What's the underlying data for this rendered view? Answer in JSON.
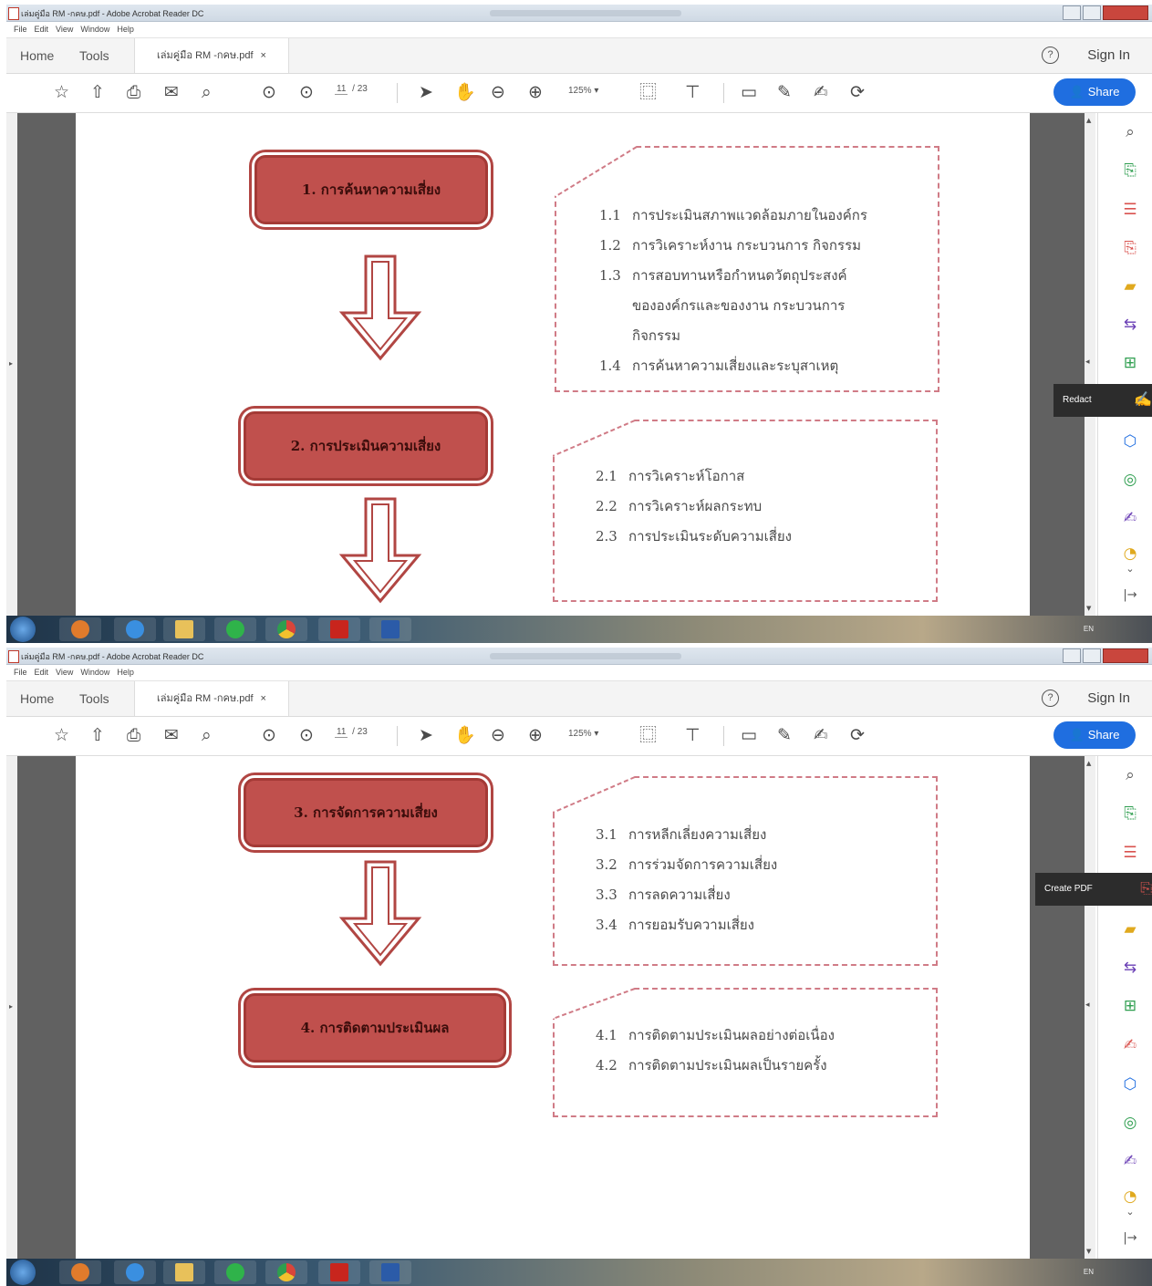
{
  "window": {
    "title": "เล่มคู่มือ RM -กคษ.pdf - Adobe Acrobat Reader DC",
    "menu": [
      "File",
      "Edit",
      "View",
      "Window",
      "Help"
    ]
  },
  "tabs": {
    "home": "Home",
    "tools": "Tools",
    "document": "เล่มคู่มือ RM -กคษ.pdf",
    "close": "×"
  },
  "header": {
    "help": "?",
    "sign_in": "Sign In",
    "share": "Share"
  },
  "toolbar": {
    "page_current": "11",
    "page_total": "/ 23",
    "zoom": "125%",
    "zoom_caret": "▾"
  },
  "tooltips": {
    "redact": "Redact",
    "create_pdf": "Create PDF"
  },
  "icons": {
    "toolbar": [
      "star-icon",
      "cloud-upload-icon",
      "print-icon",
      "mail-icon",
      "search-icon",
      "page-up-icon",
      "page-down-icon",
      "select-cursor-icon",
      "hand-icon",
      "zoom-out-icon",
      "zoom-in-icon",
      "fit-page-icon",
      "scroll-mode-icon",
      "comment-icon",
      "pen-icon",
      "sign-icon",
      "share-link-icon"
    ],
    "right_panel": [
      "zoom-icon",
      "export-pdf-icon",
      "organize-icon",
      "create-pdf-icon",
      "comment-icon",
      "convert-icon",
      "edit-pdf-icon",
      "redact-icon",
      "protect-icon",
      "optimize-icon",
      "fill-sign-icon",
      "more-tools-icon"
    ]
  },
  "colors": {
    "stage_fill": "#c0504d",
    "stage_border": "#a43a36",
    "dashed_border": "#d07b86",
    "share_button": "#1f6ee0"
  },
  "page1": {
    "stage1": "1. การค้นหาความเสี่ยง",
    "box1": [
      {
        "num": "1.1",
        "text": "การประเมินสภาพแวดล้อมภายในองค์กร"
      },
      {
        "num": "1.2",
        "text": "การวิเคราะห์งาน กระบวนการ กิจกรรม"
      },
      {
        "num": "1.3",
        "text": "การสอบทานหรือกำหนดวัตถุประสงค์"
      },
      {
        "num": "",
        "text": "ขององค์กรและของงาน กระบวนการ"
      },
      {
        "num": "",
        "text": "กิจกรรม"
      },
      {
        "num": "1.4",
        "text": "การค้นหาความเสี่ยงและระบุสาเหตุ"
      }
    ],
    "stage2": "2. การประเมินความเสี่ยง",
    "box2": [
      {
        "num": "2.1",
        "text": "การวิเคราะห์โอกาส"
      },
      {
        "num": "2.2",
        "text": "การวิเคราะห์ผลกระทบ"
      },
      {
        "num": "2.3",
        "text": "การประเมินระดับความเสี่ยง"
      }
    ]
  },
  "page2": {
    "stage3": "3. การจัดการความเสี่ยง",
    "box3": [
      {
        "num": "3.1",
        "text": "การหลีกเลี่ยงความเสี่ยง"
      },
      {
        "num": "3.2",
        "text": "การร่วมจัดการความเสี่ยง"
      },
      {
        "num": "3.3",
        "text": "การลดความเสี่ยง"
      },
      {
        "num": "3.4",
        "text": "การยอมรับความเสี่ยง"
      }
    ],
    "stage4": "4. การติดตามประเมินผล",
    "box4": [
      {
        "num": "4.1",
        "text": "การติดตามประเมินผลอย่างต่อเนื่อง"
      },
      {
        "num": "4.2",
        "text": "การติดตามประเมินผลเป็นรายครั้ง"
      }
    ]
  },
  "taskbar": {
    "language": "EN"
  }
}
